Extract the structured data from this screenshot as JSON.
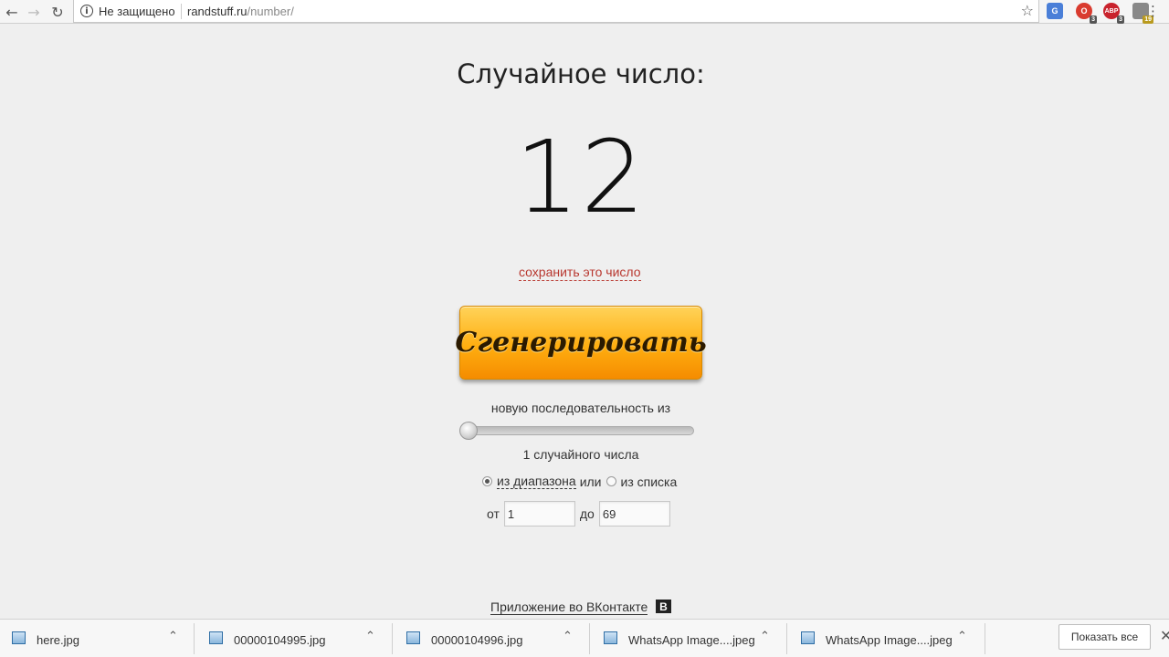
{
  "browser": {
    "security_text": "Не защищено",
    "url_host": "randstuff.ru",
    "url_path": "/number/",
    "extensions": [
      {
        "name": "google-translate",
        "color": "#4a7fd8",
        "label": "G",
        "badge": ""
      },
      {
        "name": "opera-extension",
        "color": "#d93b2f",
        "label": "O",
        "badge": "3"
      },
      {
        "name": "adblock-plus",
        "color": "#c9232d",
        "label": "ABP",
        "badge": "3"
      },
      {
        "name": "extension-puzzle",
        "color": "#888888",
        "label": "",
        "badge": "19"
      }
    ]
  },
  "main": {
    "title": "Случайное число:",
    "number": "12",
    "save_link": "сохранить это число",
    "generate_button": "Сгенерировать",
    "sequence_label": "новую последовательность из",
    "slider_value_fraction": 0,
    "count_label": "1 случайного числа",
    "mode": {
      "range_label": "из диапазона",
      "or_label": "или",
      "list_label": "из списка",
      "selected": "range"
    },
    "range": {
      "from_label": "от",
      "from_value": "1",
      "to_label": "до",
      "to_value": "69"
    },
    "vk_link": "Приложение во ВКонтакте",
    "vk_icon_label": "В"
  },
  "downloads": {
    "items": [
      {
        "name": "here.jpg"
      },
      {
        "name": "00000104995.jpg"
      },
      {
        "name": "00000104996.jpg"
      },
      {
        "name": "WhatsApp Image....jpeg"
      },
      {
        "name": "WhatsApp Image....jpeg"
      }
    ],
    "show_all_label": "Показать все"
  },
  "colors": {
    "accent_link": "#b8372f",
    "button_orange": "#ffae10"
  }
}
